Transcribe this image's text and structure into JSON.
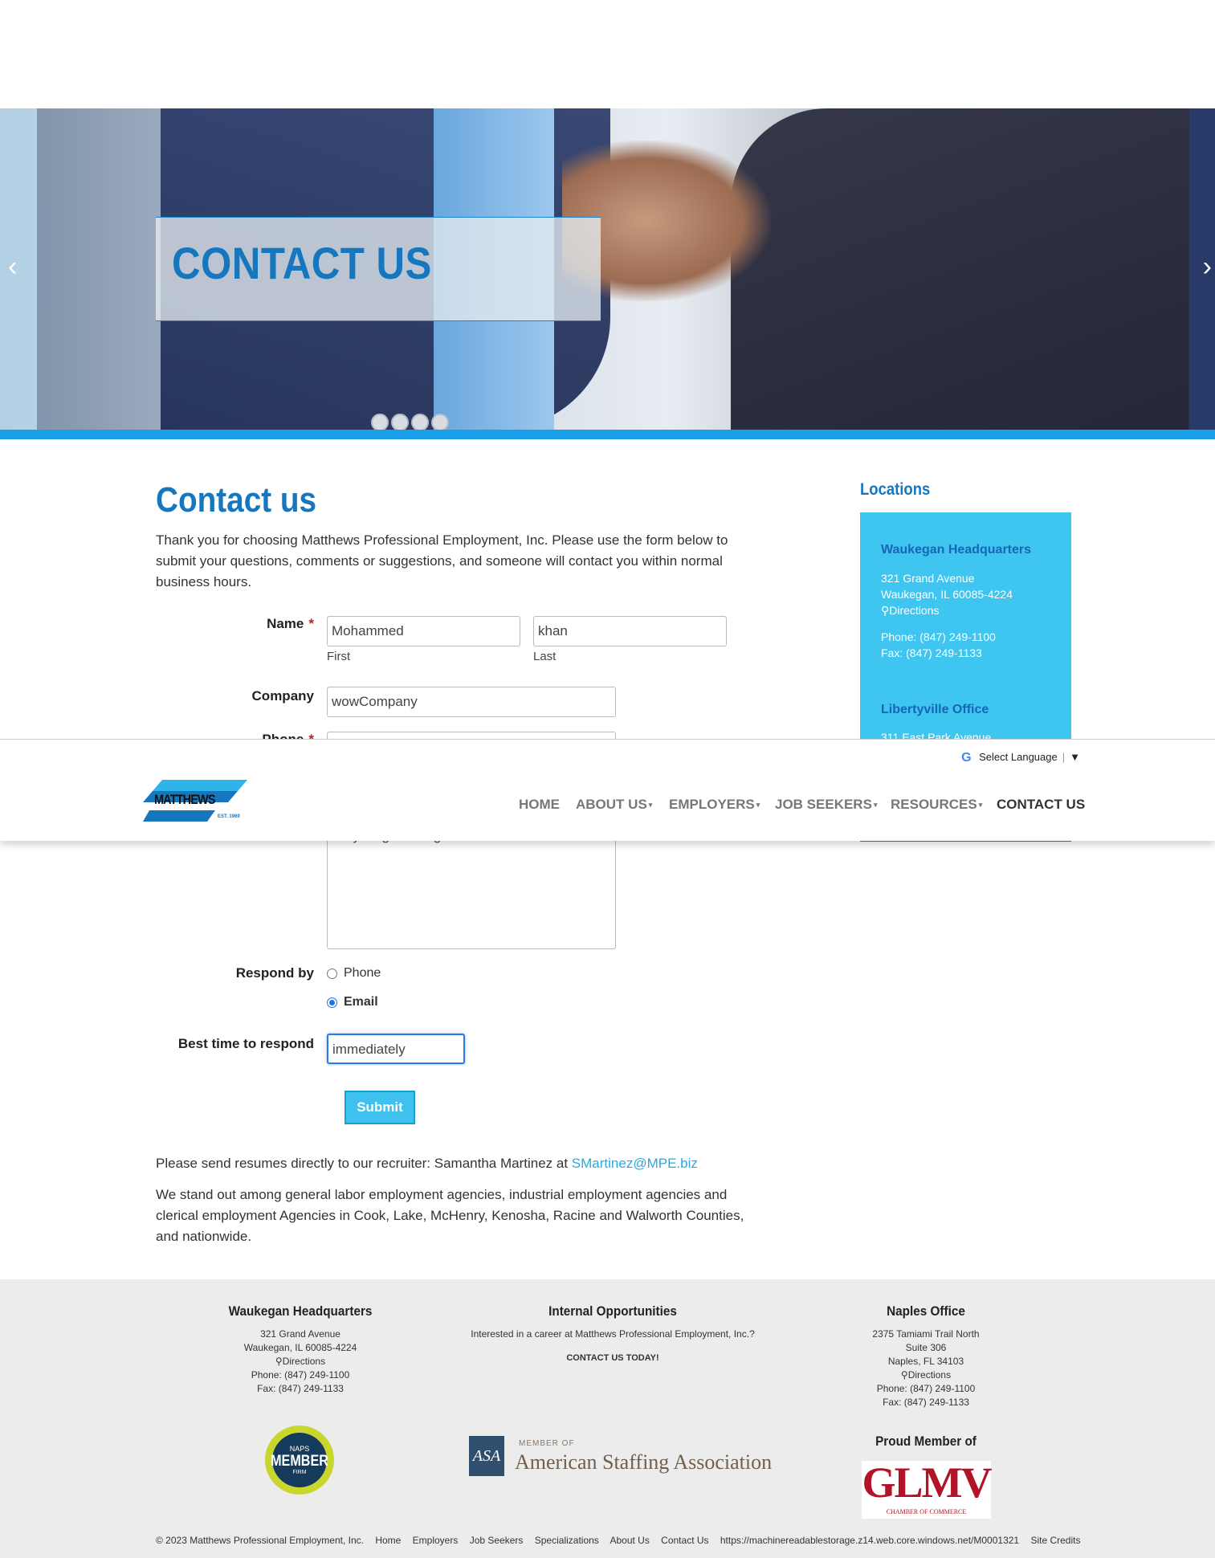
{
  "hero": {
    "title": "CONTACT US",
    "prev_arrow": "‹",
    "next_arrow": "›"
  },
  "page": {
    "heading": "Contact us",
    "intro": "Thank you for choosing Matthews Professional Employment, Inc. Please use the form below to submit your questions, comments or suggestions, and someone will contact you within normal business hours."
  },
  "form": {
    "name_label": "Name",
    "required_mark": "*",
    "first_value": "Mohammed",
    "last_value": "khan",
    "first_sub": "First",
    "last_sub": "Last",
    "company_label": "Company",
    "company_value": "wowCompany",
    "phone_label": "Phone",
    "message_value": "very long message",
    "respond_label": "Respond by",
    "respond_options": [
      "Phone",
      "Email"
    ],
    "respond_selected": "Email",
    "best_time_label": "Best time to respond",
    "best_time_value": "immediately",
    "submit_label": "Submit"
  },
  "resumes": {
    "text": "Please send resumes directly to our recruiter: Samantha Martinez at ",
    "email": "SMartinez@MPE.biz"
  },
  "standout": "We stand out among general labor employment agencies, industrial employment agencies and clerical employment Agencies in Cook, Lake, McHenry, Kenosha, Racine and Walworth Counties, and nationwide.",
  "sidebar": {
    "title": "Locations",
    "hq_name": "Waukegan Headquarters",
    "hq_addr1": "321 Grand Avenue",
    "hq_addr2": "Waukegan, IL 60085-4224",
    "hq_directions": "Directions",
    "hq_phone": "Phone: (847) 249-1100",
    "hq_fax": "Fax: (847) 249-1133",
    "office2_name": "Libertyville Office",
    "office2_addr1": "311 East Park Avenue"
  },
  "header": {
    "language_label": "Select Language",
    "language_caret": "▼",
    "logo_text": "MATTHEWS",
    "logo_est": "EST. 1969",
    "nav": [
      {
        "label": "HOME"
      },
      {
        "label": "ABOUT US"
      },
      {
        "label": "EMPLOYERS"
      },
      {
        "label": "JOB SEEKERS"
      },
      {
        "label": "RESOURCES"
      },
      {
        "label": "CONTACT US"
      }
    ]
  },
  "footer": {
    "col1": {
      "heading": "Waukegan Headquarters",
      "lines": [
        "321 Grand Avenue",
        "Waukegan, IL 60085-4224",
        "Directions",
        "Phone: (847) 249-1100",
        "Fax: (847) 249-1133"
      ]
    },
    "col2": {
      "heading": "Internal Opportunities",
      "text": "Interested in a career at Matthews Professional Employment, Inc.?",
      "cta": "CONTACT US TODAY!"
    },
    "col3": {
      "heading": "Naples Office",
      "lines": [
        "2375 Tamiami Trail North",
        "Suite 306",
        "Naples, FL 34103",
        "Directions",
        "Phone: (847) 249-1100",
        "Fax: (847) 249-1133"
      ]
    },
    "naps": {
      "top": "NAPS",
      "main": "MEMBER",
      "bottom": "FIRM"
    },
    "asa": {
      "mark": "ASA",
      "member_of": "MEMBER OF",
      "name": "American Staffing Association"
    },
    "proud_member": "Proud Member of",
    "glmv": {
      "mark": "GLMV",
      "sub": "CHAMBER OF COMMERCE"
    },
    "bottom_links": [
      "© 2023 Matthews Professional Employment, Inc.",
      "Home",
      "Employers",
      "Job Seekers",
      "Specializations",
      "About Us",
      "Contact Us",
      "https://machinereadablestorage.z14.web.core.windows.net/M0001321",
      "Site Credits"
    ]
  },
  "colors": {
    "brand_blue": "#1677be",
    "accent_cyan": "#3ec5f0",
    "bar_blue": "#1aa0e8"
  }
}
